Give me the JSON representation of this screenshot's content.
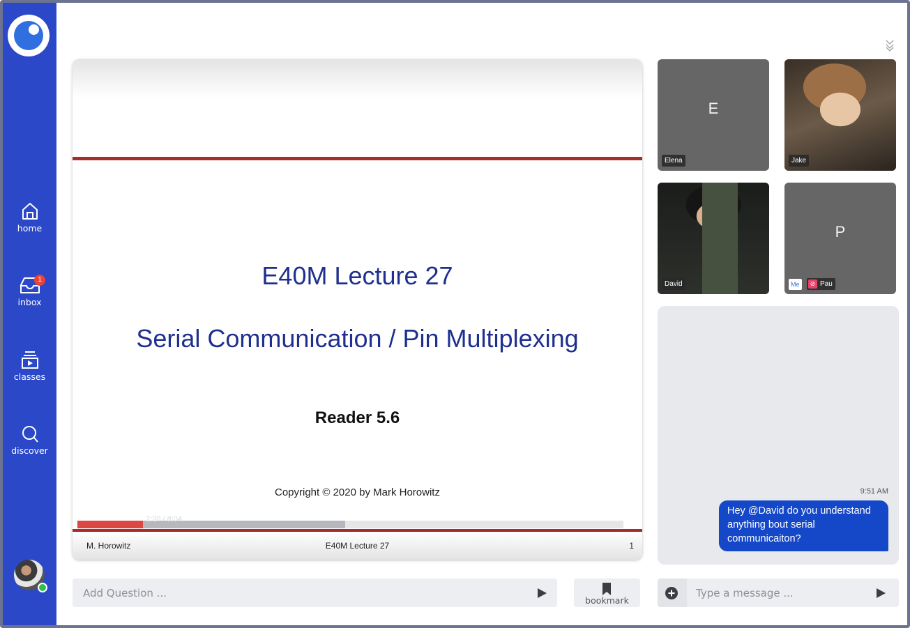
{
  "sidebar": {
    "items": [
      {
        "label": "home",
        "icon": "home-icon"
      },
      {
        "label": "inbox",
        "icon": "inbox-icon",
        "badge": "1"
      },
      {
        "label": "classes",
        "icon": "classes-icon"
      },
      {
        "label": "discover",
        "icon": "search-icon"
      }
    ]
  },
  "slide": {
    "title": "E40M Lecture 27",
    "subtitle": "Serial Communication / Pin Multiplexing",
    "reader": "Reader 5.6",
    "copyright": "Copyright © 2020 by Mark Horowitz",
    "footer_left": "M. Horowitz",
    "footer_center": "E40M Lecture 27",
    "footer_right": "1",
    "time": "2:20 / 8:04",
    "progress_played": 0.12,
    "progress_buffered": 0.49
  },
  "participants": [
    {
      "name": "Elena",
      "letter": "E"
    },
    {
      "name": "Jake"
    },
    {
      "name": "David"
    },
    {
      "name": "Pau",
      "letter": "P",
      "me_label": "Me"
    }
  ],
  "chat": {
    "time": "9:51 AM",
    "message": "Hey @David do you understand anything bout serial communicaiton?",
    "placeholder": "Type a message ..."
  },
  "question": {
    "placeholder": "Add Question ..."
  },
  "bookmark": {
    "label": "bookmark"
  },
  "colors": {
    "sidebar": "#2a48c7",
    "accent": "#1547c9",
    "slide_text": "#1f2f8f",
    "rule": "#a32e2a",
    "progress": "#dc4744"
  }
}
